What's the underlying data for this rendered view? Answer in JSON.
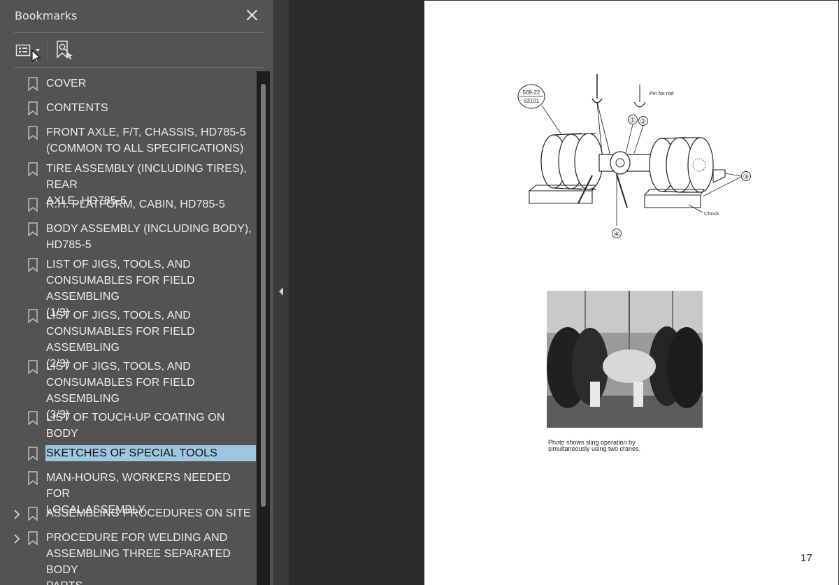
{
  "panel": {
    "title": "Bookmarks",
    "close_icon": "close-icon",
    "toolbar": {
      "options_icon": "list-options-icon",
      "find_icon": "bookmark-search-icon"
    }
  },
  "bookmarks": [
    {
      "label": "COVER",
      "expandable": false,
      "selected": false
    },
    {
      "label": "CONTENTS",
      "expandable": false,
      "selected": false
    },
    {
      "label": "FRONT AXLE, F/T, CHASSIS, HD785-5\n(COMMON TO ALL SPECIFICATIONS)",
      "expandable": false,
      "selected": false
    },
    {
      "label": "TIRE ASSEMBLY (INCLUDING TIRES), REAR\nAXLE, HD785-5",
      "expandable": false,
      "selected": false
    },
    {
      "label": "R.H. PLATFORM, CABIN, HD785-5",
      "expandable": false,
      "selected": false
    },
    {
      "label": "BODY ASSEMBLY (INCLUDING BODY),\nHD785-5",
      "expandable": false,
      "selected": false
    },
    {
      "label": "LIST OF JIGS, TOOLS, AND\nCONSUMABLES FOR FIELD ASSEMBLING\n(1/3)",
      "expandable": false,
      "selected": false
    },
    {
      "label": "LIST OF JIGS, TOOLS, AND\nCONSUMABLES FOR FIELD ASSEMBLING\n(2/3)",
      "expandable": false,
      "selected": false
    },
    {
      "label": "LIST OF JIGS, TOOLS, AND\nCONSUMABLES FOR FIELD ASSEMBLING\n(3/3)",
      "expandable": false,
      "selected": false
    },
    {
      "label": "LIST OF TOUCH-UP COATING ON BODY\nFOR OVERSEAS SPECIFICATIONS",
      "expandable": false,
      "selected": false
    },
    {
      "label": "SKETCHES OF SPECIAL TOOLS",
      "expandable": false,
      "selected": true
    },
    {
      "label": "MAN-HOURS, WORKERS NEEDED FOR\nLOCAL ASSEMBLY",
      "expandable": false,
      "selected": false
    },
    {
      "label": "ASSEMBLING PROCEDURES ON SITE",
      "expandable": true,
      "selected": false
    },
    {
      "label": "PROCEDURE FOR WELDING AND\nASSEMBLING THREE SEPARATED BODY\nPARTS",
      "expandable": true,
      "selected": false
    }
  ],
  "document": {
    "page_number": "17",
    "diagram": {
      "badge_top": "569-22",
      "badge_bottom": "63101",
      "pin_label": "Pin for rod",
      "chock_label": "Chock",
      "callouts": [
        "①",
        "②",
        "③",
        "④"
      ]
    },
    "photo_caption": "Photo shows sling operation by\nsimultaneously using two cranes."
  }
}
